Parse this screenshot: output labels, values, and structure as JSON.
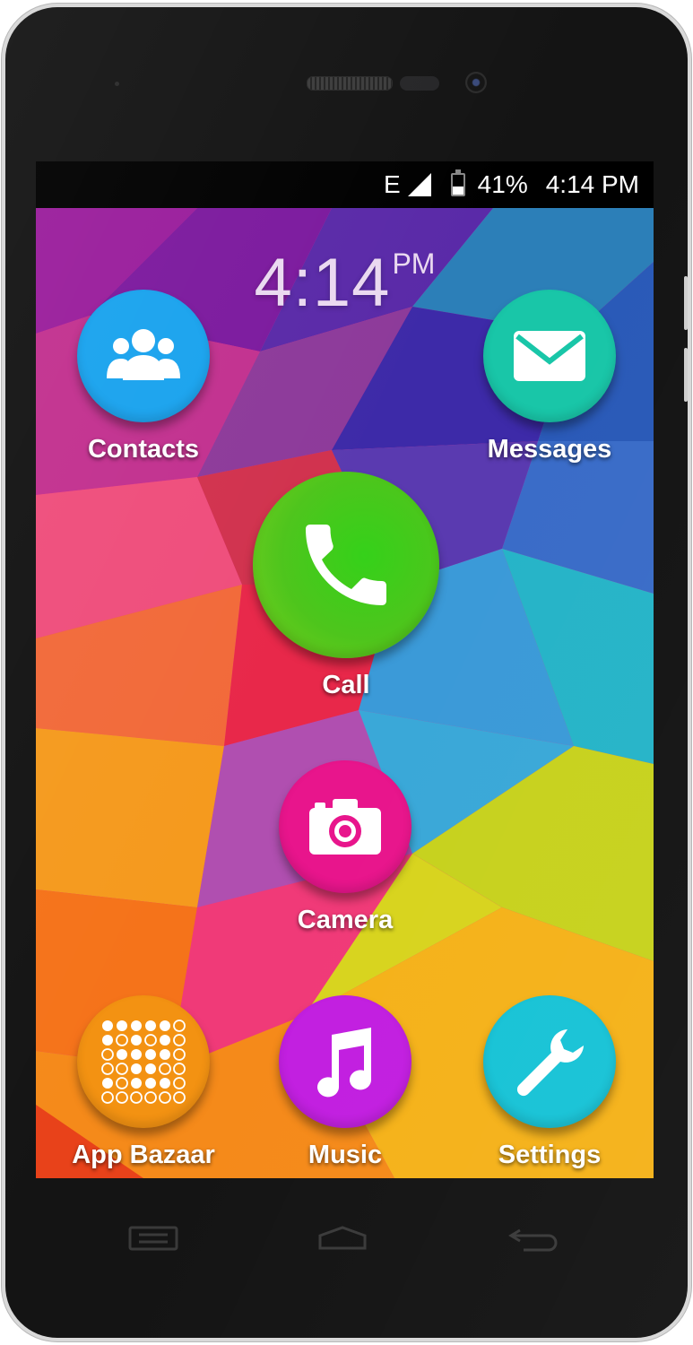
{
  "status_bar": {
    "network_type": "E",
    "battery_percent": "41%",
    "battery_level": 0.41,
    "time": "4:14 PM"
  },
  "clock": {
    "time": "4:14",
    "ampm": "PM"
  },
  "apps": {
    "contacts": {
      "label": "Contacts",
      "color": "#1aa3ee",
      "icon": "contacts-icon"
    },
    "messages": {
      "label": "Messages",
      "color": "#19c6a8",
      "icon": "envelope-icon"
    },
    "call": {
      "label": "Call",
      "color": "#3fc51b",
      "icon": "phone-icon"
    },
    "camera": {
      "label": "Camera",
      "color": "#e8158c",
      "icon": "camera-icon"
    },
    "app_bazaar": {
      "label": "App Bazaar",
      "color": "#f39212",
      "icon": "grid-dots-icon"
    },
    "music": {
      "label": "Music",
      "color": "#c21fe0",
      "icon": "music-note-icon"
    },
    "settings": {
      "label": "Settings",
      "color": "#18c3d6",
      "icon": "wrench-icon"
    }
  },
  "nav_keys": {
    "menu": "menu-icon",
    "home": "home-icon",
    "back": "back-icon"
  }
}
